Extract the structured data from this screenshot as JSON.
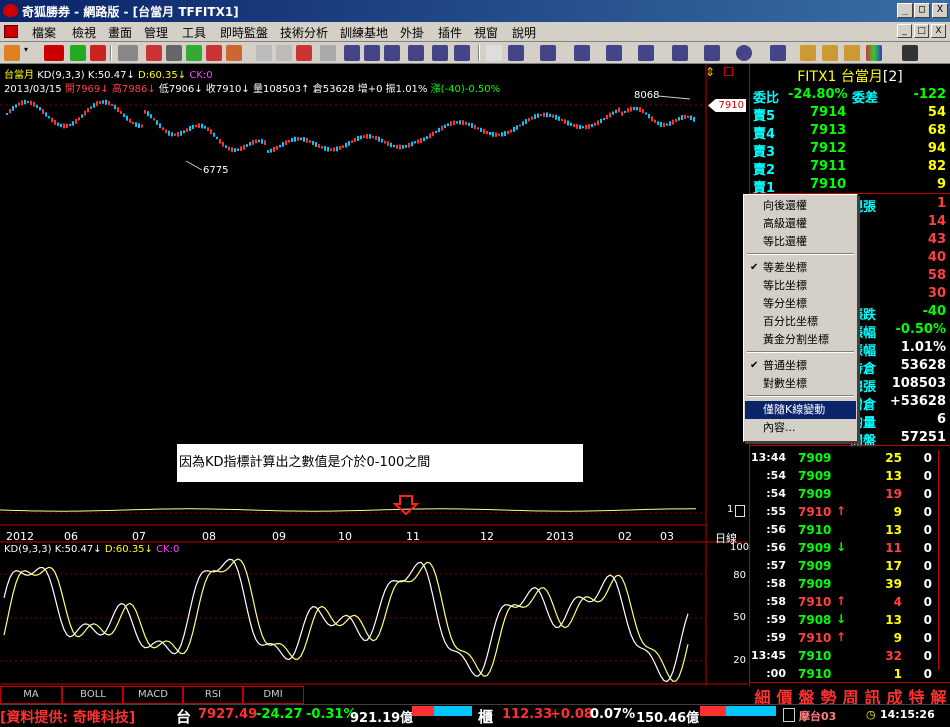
{
  "window": {
    "title": "奇狐勝券 - 網路版 - [台當月 TFFITX1]",
    "buttons": [
      "_",
      "□",
      "X"
    ]
  },
  "menu": {
    "items": [
      "檔案",
      "檢視",
      "畫面",
      "管理",
      "工具",
      "即時監盤",
      "技術分析",
      "訓練基地",
      "外掛",
      "插件",
      "視窗",
      "說明"
    ],
    "mdi_buttons": [
      "_",
      "□",
      "X"
    ]
  },
  "chart": {
    "header_line1": {
      "name": "台當月",
      "kd": "KD(9,3,3)",
      "k": "K:50.47",
      "d": "D:60.35",
      "ck": "CK:0"
    },
    "header_line2": {
      "date": "2013/03/15",
      "open": "開7969",
      "high": "高7986",
      "low": "低7906",
      "close": "收7910",
      "volume": "量108503",
      "oi": "倉53628",
      "increase": "增+0",
      "amplitude": "振1.01%",
      "change": "漲(-40)-0.50%"
    },
    "annotations": {
      "high_label": "8068",
      "low_label": "6775",
      "price_tag": "7910",
      "scale_mark": "1"
    },
    "note": "因為KD指標計算出之數值是介於0-100之間",
    "x_axis": [
      "2012",
      "06",
      "07",
      "08",
      "09",
      "10",
      "11",
      "12",
      "2013",
      "02",
      "03"
    ],
    "x_axis_unit": "日線",
    "kd_header": {
      "kd": "KD(9,3,3)",
      "k": "K:50.47",
      "d": "D:60.35",
      "ck": "CK:0"
    },
    "kd_scale": [
      "100",
      "80",
      "50",
      "20"
    ],
    "tabs": [
      "MA",
      "BOLL",
      "MACD",
      "RSI",
      "DMI"
    ]
  },
  "panel": {
    "title": "FITX1 台當月",
    "title_suffix": "[2]",
    "ratio": {
      "label": "委比",
      "value": "-24.80%",
      "label2": "委差",
      "value2": "-122"
    },
    "asks": [
      {
        "label": "賣5",
        "price": "7914",
        "qty": "54"
      },
      {
        "label": "賣4",
        "price": "7913",
        "qty": "68"
      },
      {
        "label": "賣3",
        "price": "7912",
        "qty": "94"
      },
      {
        "label": "賣2",
        "price": "7911",
        "qty": "82"
      },
      {
        "label": "賣1",
        "price": "7910",
        "qty": "9"
      }
    ],
    "hidden_rows": [
      {
        "label": "現張",
        "value": "1"
      },
      {
        "label": "",
        "value": "14"
      },
      {
        "label": "",
        "value": "43"
      },
      {
        "label": "",
        "value": "40"
      },
      {
        "label": "",
        "value": "58"
      },
      {
        "label": "",
        "value": "30"
      }
    ],
    "stats": [
      {
        "label": "漲跌",
        "value": "-40"
      },
      {
        "label": "漲幅",
        "value": "-0.50%"
      },
      {
        "label": "振幅",
        "value": "1.01%"
      },
      {
        "label": "持倉",
        "value": "53628"
      },
      {
        "label": "總張",
        "value": "108503"
      },
      {
        "label": "增倉",
        "value": "+53628"
      },
      {
        "label": "均量",
        "value": "6"
      },
      {
        "label": "開盤",
        "value": "57251"
      }
    ],
    "ticks": [
      {
        "time": "13:44",
        "price": "7909",
        "arrow": "",
        "qty": "25",
        "flag": "0"
      },
      {
        "time": ":54",
        "price": "7909",
        "arrow": "",
        "qty": "13",
        "flag": "0"
      },
      {
        "time": ":54",
        "price": "7909",
        "arrow": "",
        "qty": "19",
        "flag": "0"
      },
      {
        "time": ":55",
        "price": "7910",
        "arrow": "↑",
        "qty": "9",
        "flag": "0"
      },
      {
        "time": ":56",
        "price": "7910",
        "arrow": "",
        "qty": "13",
        "flag": "0"
      },
      {
        "time": ":56",
        "price": "7909",
        "arrow": "↓",
        "qty": "11",
        "flag": "0"
      },
      {
        "time": ":57",
        "price": "7909",
        "arrow": "",
        "qty": "17",
        "flag": "0"
      },
      {
        "time": ":58",
        "price": "7909",
        "arrow": "",
        "qty": "39",
        "flag": "0"
      },
      {
        "time": ":58",
        "price": "7910",
        "arrow": "↑",
        "qty": "4",
        "flag": "0"
      },
      {
        "time": ":59",
        "price": "7908",
        "arrow": "↓",
        "qty": "13",
        "flag": "0"
      },
      {
        "time": ":59",
        "price": "7910",
        "arrow": "↑",
        "qty": "9",
        "flag": "0"
      },
      {
        "time": "13:45",
        "price": "7910",
        "arrow": "",
        "qty": "32",
        "flag": "0"
      },
      {
        "time": ":00",
        "price": "7910",
        "arrow": "",
        "qty": "1",
        "flag": "0"
      }
    ],
    "bottom_tabs": [
      "細",
      "價",
      "盤",
      "勢",
      "周",
      "訊",
      "成",
      "特",
      "解"
    ]
  },
  "context_menu": {
    "items": [
      {
        "label": "向後還權",
        "checked": false,
        "selected": false
      },
      {
        "label": "高級還權",
        "checked": false,
        "selected": false
      },
      {
        "label": "等比還權",
        "checked": false,
        "selected": false
      },
      {
        "sep": true
      },
      {
        "label": "等差坐標",
        "checked": true,
        "selected": false
      },
      {
        "label": "等比坐標",
        "checked": false,
        "selected": false
      },
      {
        "label": "等分坐標",
        "checked": false,
        "selected": false
      },
      {
        "label": "百分比坐標",
        "checked": false,
        "selected": false
      },
      {
        "label": "黃金分割坐標",
        "checked": false,
        "selected": false
      },
      {
        "sep": true
      },
      {
        "label": "普通坐標",
        "checked": true,
        "selected": false
      },
      {
        "label": "對數坐標",
        "checked": false,
        "selected": false
      },
      {
        "sep": true
      },
      {
        "label": "僅隨K線變動",
        "checked": false,
        "selected": true
      },
      {
        "label": "內容...",
        "checked": false,
        "selected": false
      }
    ]
  },
  "status": {
    "provider": "[資料提供: 奇唯科技]",
    "idx1_label": "台",
    "idx1_value": "7927.49",
    "idx1_change": "-24.27",
    "idx1_pct": "-0.31%",
    "idx1_amount": "921.19億",
    "idx2_label": "櫃",
    "idx2_value": "112.33",
    "idx2_change": "+0.08",
    "idx2_pct": "0.07%",
    "idx2_amount": "150.46億",
    "server": "摩台03",
    "time": "14:15:26"
  },
  "colors": {
    "background": "#000000",
    "up": "#ff4040",
    "down": "#00ff00",
    "label": "#00ffff",
    "price_line": "#ffff00",
    "k_line": "#ffffff",
    "d_line": "#ffff80"
  }
}
